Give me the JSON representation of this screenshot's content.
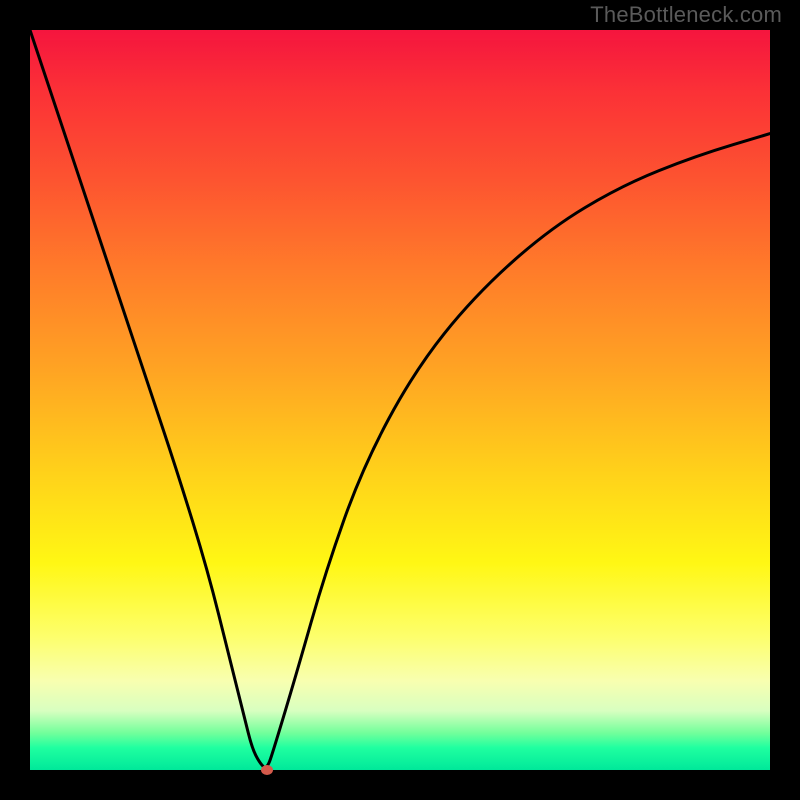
{
  "watermark": "TheBottleneck.com",
  "colors": {
    "page_bg": "#000000",
    "gradient_top": "#f5153e",
    "gradient_bottom": "#00e89a",
    "curve": "#000000",
    "dot": "#d45a4b",
    "watermark": "#5a5a5a"
  },
  "chart_data": {
    "type": "line",
    "title": "",
    "xlabel": "",
    "ylabel": "",
    "xlim": [
      0,
      100
    ],
    "ylim": [
      0,
      100
    ],
    "grid": false,
    "legend": false,
    "annotations": [
      {
        "kind": "min-marker",
        "x": 32,
        "y": 0
      }
    ],
    "series": [
      {
        "name": "bottleneck-curve",
        "x": [
          0,
          4,
          8,
          12,
          16,
          20,
          24,
          27,
          29,
          30,
          31,
          32,
          33,
          36,
          40,
          45,
          52,
          60,
          70,
          80,
          90,
          100
        ],
        "values": [
          100,
          88,
          76,
          64,
          52,
          40,
          27,
          15,
          7,
          3,
          1,
          0,
          3,
          13,
          27,
          41,
          54,
          64,
          73,
          79,
          83,
          86
        ]
      }
    ]
  }
}
